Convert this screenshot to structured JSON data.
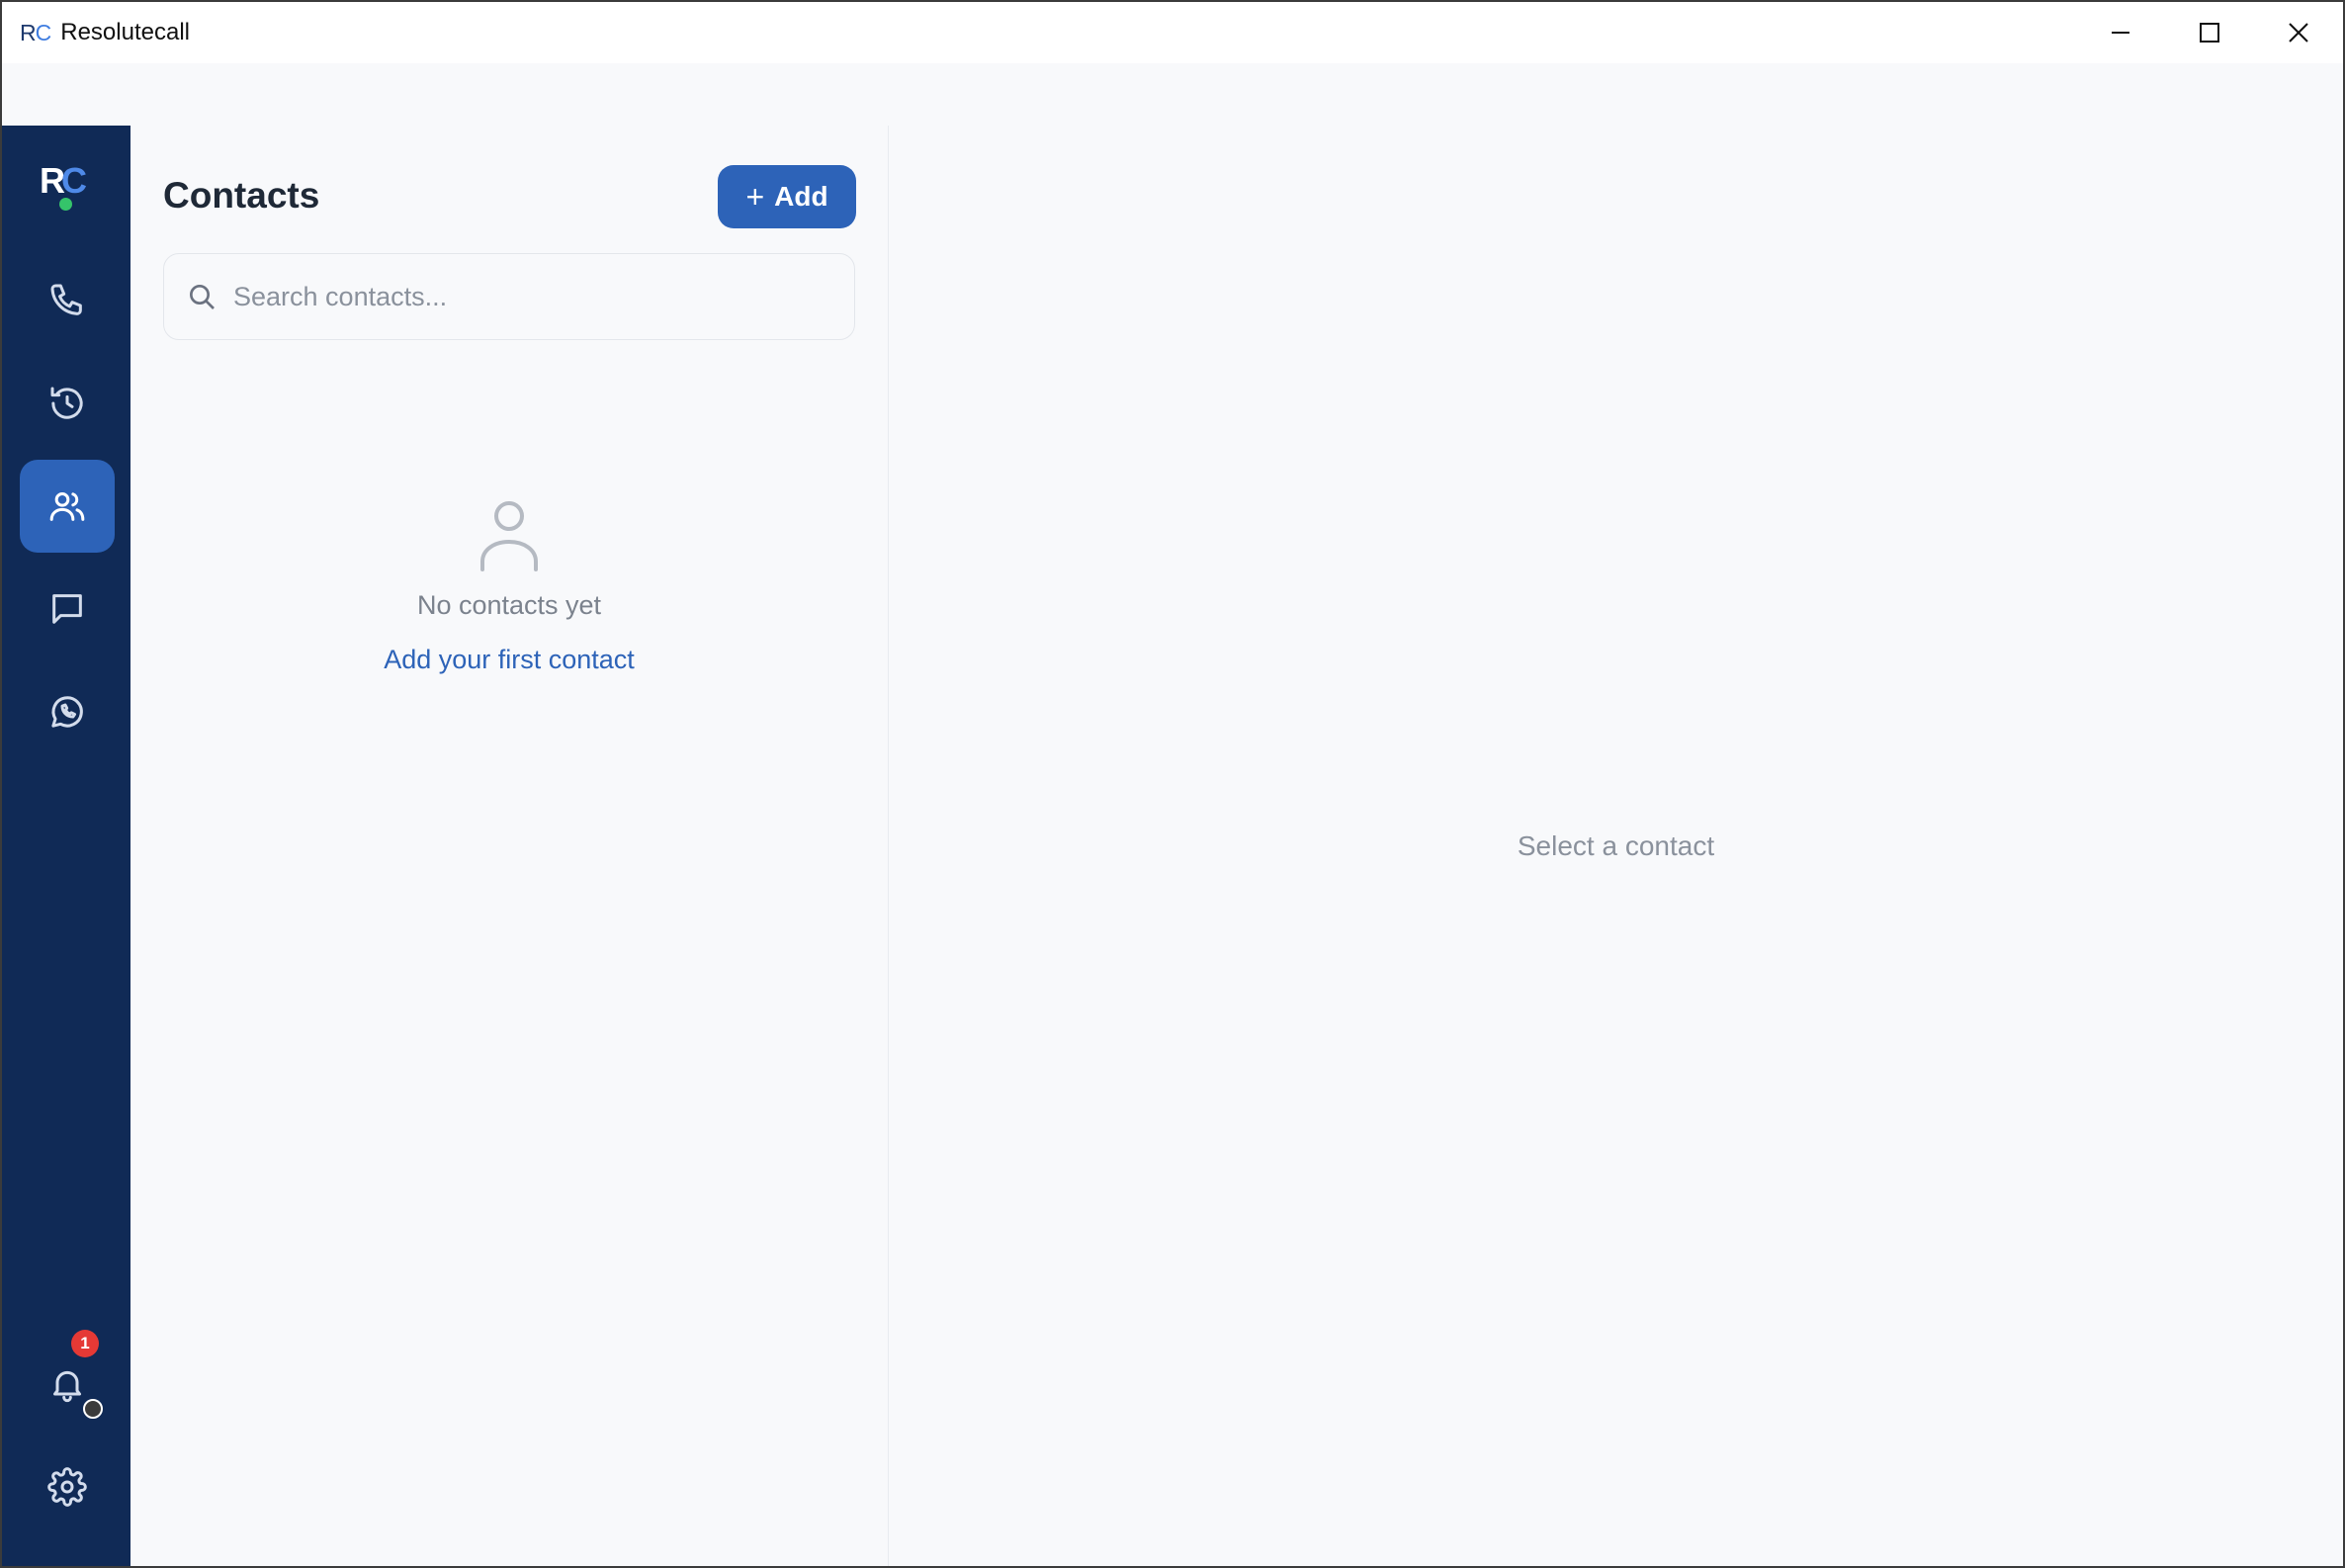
{
  "window": {
    "logo_r": "R",
    "logo_c": "C",
    "title": "Resolutecall"
  },
  "sidebar": {
    "logo_r": "R",
    "logo_c": "C",
    "items": [
      {
        "name": "phone",
        "icon": "phone-icon",
        "active": false
      },
      {
        "name": "history",
        "icon": "history-icon",
        "active": false
      },
      {
        "name": "contacts",
        "icon": "users-icon",
        "active": true
      },
      {
        "name": "messages",
        "icon": "message-icon",
        "active": false
      },
      {
        "name": "whatsapp",
        "icon": "whatsapp-icon",
        "active": false
      }
    ],
    "notifications": {
      "icon": "bell-icon",
      "badge_count": "1"
    },
    "settings": {
      "icon": "gear-icon"
    }
  },
  "contacts": {
    "title": "Contacts",
    "add_label": "Add",
    "search_placeholder": "Search contacts...",
    "empty_text": "No contacts yet",
    "empty_link": "Add your first contact"
  },
  "detail": {
    "placeholder_text": "Select a contact"
  },
  "colors": {
    "sidebar_bg": "#102a56",
    "accent": "#2d63b8",
    "badge": "#e53935",
    "online": "#35c46a"
  }
}
